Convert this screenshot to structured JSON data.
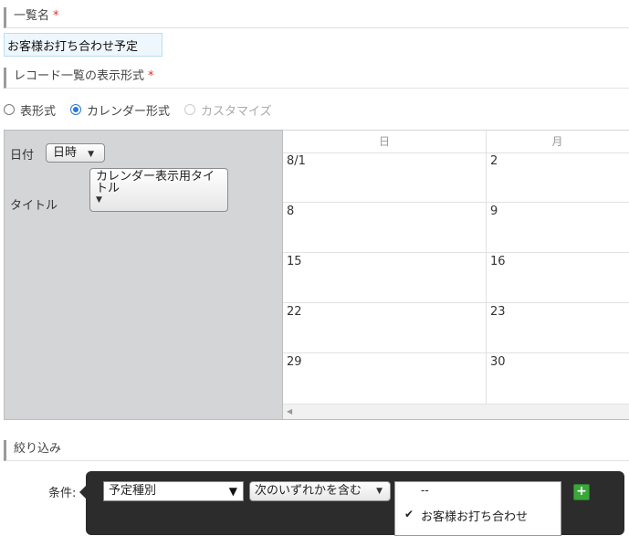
{
  "list_name": {
    "label": "一覧名",
    "required_mark": "*",
    "value": "お客様お打ち合わせ予定"
  },
  "display_format": {
    "label": "レコード一覧の表示形式",
    "required_mark": "*",
    "options": [
      {
        "label": "表形式",
        "selected": false,
        "disabled": false
      },
      {
        "label": "カレンダー形式",
        "selected": true,
        "disabled": false
      },
      {
        "label": "カスタマイズ",
        "selected": false,
        "disabled": true
      }
    ]
  },
  "calendar_settings": {
    "date_label": "日付",
    "date_field": "日時",
    "title_label": "タイトル",
    "title_field": "カレンダー表示用タイトル"
  },
  "calendar_preview": {
    "columns": [
      "日",
      "月"
    ],
    "rows": [
      [
        "8/1",
        "2"
      ],
      [
        "8",
        "9"
      ],
      [
        "15",
        "16"
      ],
      [
        "22",
        "23"
      ],
      [
        "29",
        "30"
      ]
    ]
  },
  "filter": {
    "label": "絞り込み",
    "condition_label": "条件:",
    "field": "予定種別",
    "operator": "次のいずれかを含む",
    "options": [
      {
        "label": "--",
        "selected": false
      },
      {
        "label": "お客様お打ち合わせ",
        "selected": true
      }
    ],
    "add_button": "+"
  },
  "icons": {
    "checkmark": "check-icon",
    "dropdown": "caret-down-icon",
    "add": "plus-icon"
  },
  "colors": {
    "accent_radio": "#2b78d6",
    "required": "#e02b2b",
    "add_button": "#3aa73a",
    "filter_panel": "#2c2c2c"
  }
}
